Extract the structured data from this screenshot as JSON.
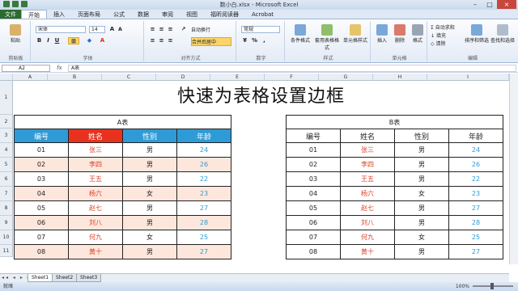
{
  "window": {
    "title": "数小白.xlsx - Microsoft Excel"
  },
  "tabs": [
    "文件",
    "开始",
    "插入",
    "页面布局",
    "公式",
    "数据",
    "审阅",
    "视图",
    "福昕阅读器",
    "Acrobat"
  ],
  "ribbon": {
    "paste": "粘贴",
    "font_name": "宋体",
    "font_size": "14",
    "wrap_text": "自动换行",
    "merge_center": "合并后居中",
    "number_format": "常规",
    "cond_format": "条件格式",
    "table_format": "套用表格格式",
    "cell_style": "单元格样式",
    "insert": "插入",
    "delete": "删除",
    "format": "格式",
    "autosum": "自动求和",
    "fill": "填充",
    "clear": "清除",
    "sort_filter": "排序和筛选",
    "find_select": "查找和选择",
    "groups": [
      "剪贴板",
      "字体",
      "对齐方式",
      "数字",
      "样式",
      "单元格",
      "编辑"
    ]
  },
  "formula_bar": {
    "name_box": "A2",
    "fx": "fx",
    "content": "A表"
  },
  "columns": [
    "A",
    "B",
    "C",
    "D",
    "E",
    "F",
    "G",
    "H",
    "I"
  ],
  "rows": [
    "1",
    "2",
    "3",
    "4",
    "5",
    "6",
    "7",
    "8",
    "9",
    "10",
    "11"
  ],
  "sheet_title": "快速为表格设置边框",
  "table_a": {
    "caption": "A表",
    "headers": [
      "编号",
      "姓名",
      "性别",
      "年龄"
    ],
    "rows": [
      [
        "01",
        "张三",
        "男",
        "24"
      ],
      [
        "02",
        "李四",
        "男",
        "26"
      ],
      [
        "03",
        "王五",
        "男",
        "22"
      ],
      [
        "04",
        "杨六",
        "女",
        "23"
      ],
      [
        "05",
        "赵七",
        "男",
        "27"
      ],
      [
        "06",
        "刘八",
        "男",
        "28"
      ],
      [
        "07",
        "何九",
        "女",
        "25"
      ],
      [
        "08",
        "黄十",
        "男",
        "27"
      ]
    ]
  },
  "table_b": {
    "caption": "B表",
    "headers": [
      "编号",
      "姓名",
      "性别",
      "年龄"
    ],
    "rows": [
      [
        "01",
        "张三",
        "男",
        "24"
      ],
      [
        "02",
        "李四",
        "男",
        "26"
      ],
      [
        "03",
        "王五",
        "男",
        "22"
      ],
      [
        "04",
        "杨六",
        "女",
        "23"
      ],
      [
        "05",
        "赵七",
        "男",
        "27"
      ],
      [
        "06",
        "刘八",
        "男",
        "28"
      ],
      [
        "07",
        "何九",
        "女",
        "25"
      ],
      [
        "08",
        "黄十",
        "男",
        "27"
      ]
    ]
  },
  "sheets": [
    "Sheet1",
    "Sheet2",
    "Sheet3"
  ],
  "status": {
    "ready": "就绪",
    "zoom": "100%"
  },
  "colors": {
    "header_blue": "#2e9bd6",
    "header_red": "#e8311e",
    "row_shade": "#fde7dc",
    "name_red": "#d9432a",
    "age_blue": "#2e9bd6"
  }
}
